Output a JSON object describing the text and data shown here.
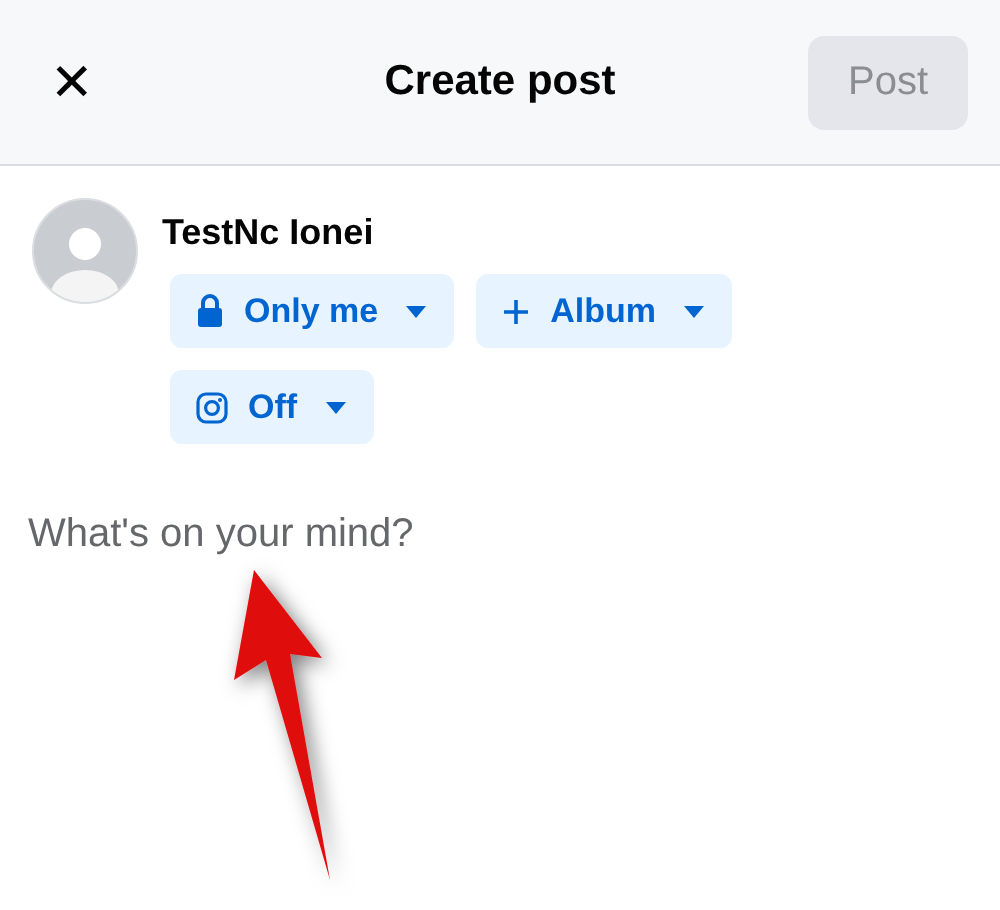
{
  "header": {
    "close": "✕",
    "title": "Create post",
    "post_button": {
      "label": "Post",
      "disabled": true
    }
  },
  "author": {
    "name": "TestNc Ionei"
  },
  "chips": [
    {
      "kind": "lock",
      "label": "Only me"
    },
    {
      "kind": "plus",
      "label": "Album"
    },
    {
      "kind": "instagram",
      "label": "Off"
    }
  ],
  "composer": {
    "placeholder": "What's on your mind?"
  },
  "annotation": {
    "kind": "arrow"
  }
}
